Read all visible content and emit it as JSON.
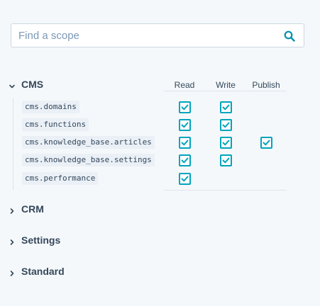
{
  "search": {
    "placeholder": "Find a scope",
    "value": ""
  },
  "columns": {
    "read": "Read",
    "write": "Write",
    "publish": "Publish"
  },
  "sections": [
    {
      "title": "CMS",
      "expanded": true
    },
    {
      "title": "CRM",
      "expanded": false
    },
    {
      "title": "Settings",
      "expanded": false
    },
    {
      "title": "Standard",
      "expanded": false
    }
  ],
  "scopes": [
    {
      "name": "cms.domains",
      "read": true,
      "write": true,
      "publish": false
    },
    {
      "name": "cms.functions",
      "read": true,
      "write": true,
      "publish": false
    },
    {
      "name": "cms.knowledge_base.articles",
      "read": true,
      "write": true,
      "publish": true
    },
    {
      "name": "cms.knowledge_base.settings",
      "read": true,
      "write": true,
      "publish": false
    },
    {
      "name": "cms.performance",
      "read": true,
      "write": false,
      "publish": false
    }
  ],
  "colors": {
    "accent": "#00a4bd",
    "text": "#33475b",
    "background": "#f5f8fa",
    "code_background": "#eaf0f6"
  }
}
